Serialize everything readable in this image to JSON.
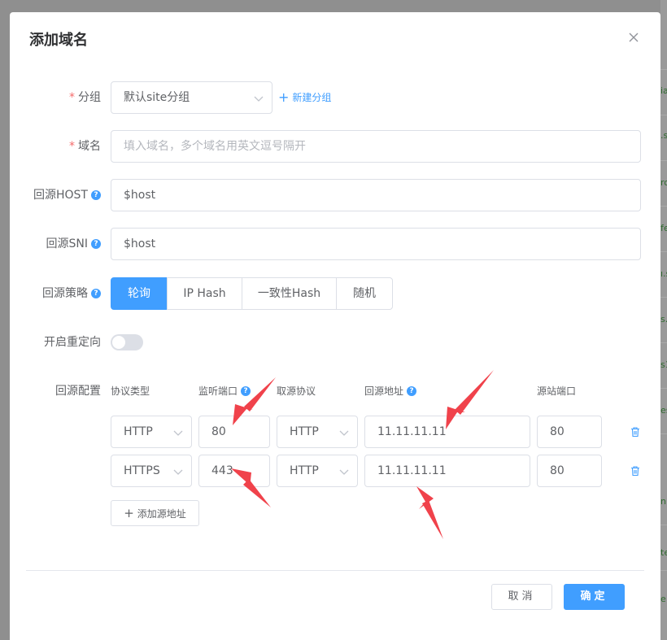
{
  "dialog": {
    "title": "添加域名",
    "close_icon": "close-icon"
  },
  "form": {
    "group": {
      "label": "分组",
      "value": "默认site分组",
      "new_group_label": "新建分组"
    },
    "domain": {
      "label": "域名",
      "placeholder": "填入域名，多个域名用英文逗号隔开"
    },
    "origin_host": {
      "label": "回源HOST",
      "value": "$host",
      "help": "?"
    },
    "origin_sni": {
      "label": "回源SNI",
      "value": "$host",
      "help": "?"
    },
    "strategy": {
      "label": "回源策略",
      "help": "?",
      "options": [
        "轮询",
        "IP Hash",
        "一致性Hash",
        "随机"
      ],
      "selected": "轮询"
    },
    "redirect": {
      "label": "开启重定向",
      "enabled": false
    },
    "origin_config": {
      "label": "回源配置",
      "columns": {
        "protocol_type": "协议类型",
        "listen_port": "监听端口",
        "origin_protocol": "取源协议",
        "origin_address": "回源地址",
        "origin_port": "源站端口",
        "help": "?"
      },
      "rows": [
        {
          "protocol": "HTTP",
          "listen_port": "80",
          "origin_protocol": "HTTP",
          "address": "11.11.11.11",
          "origin_port": "80"
        },
        {
          "protocol": "HTTPS",
          "listen_port": "443",
          "origin_protocol": "HTTP",
          "address": "11.11.11.11",
          "origin_port": "80"
        }
      ],
      "add_label": "添加源地址"
    }
  },
  "footer": {
    "cancel_label": "取消",
    "ok_label": "确定"
  },
  "annotation_color": "#f0424b",
  "accent_color": "#409eff"
}
